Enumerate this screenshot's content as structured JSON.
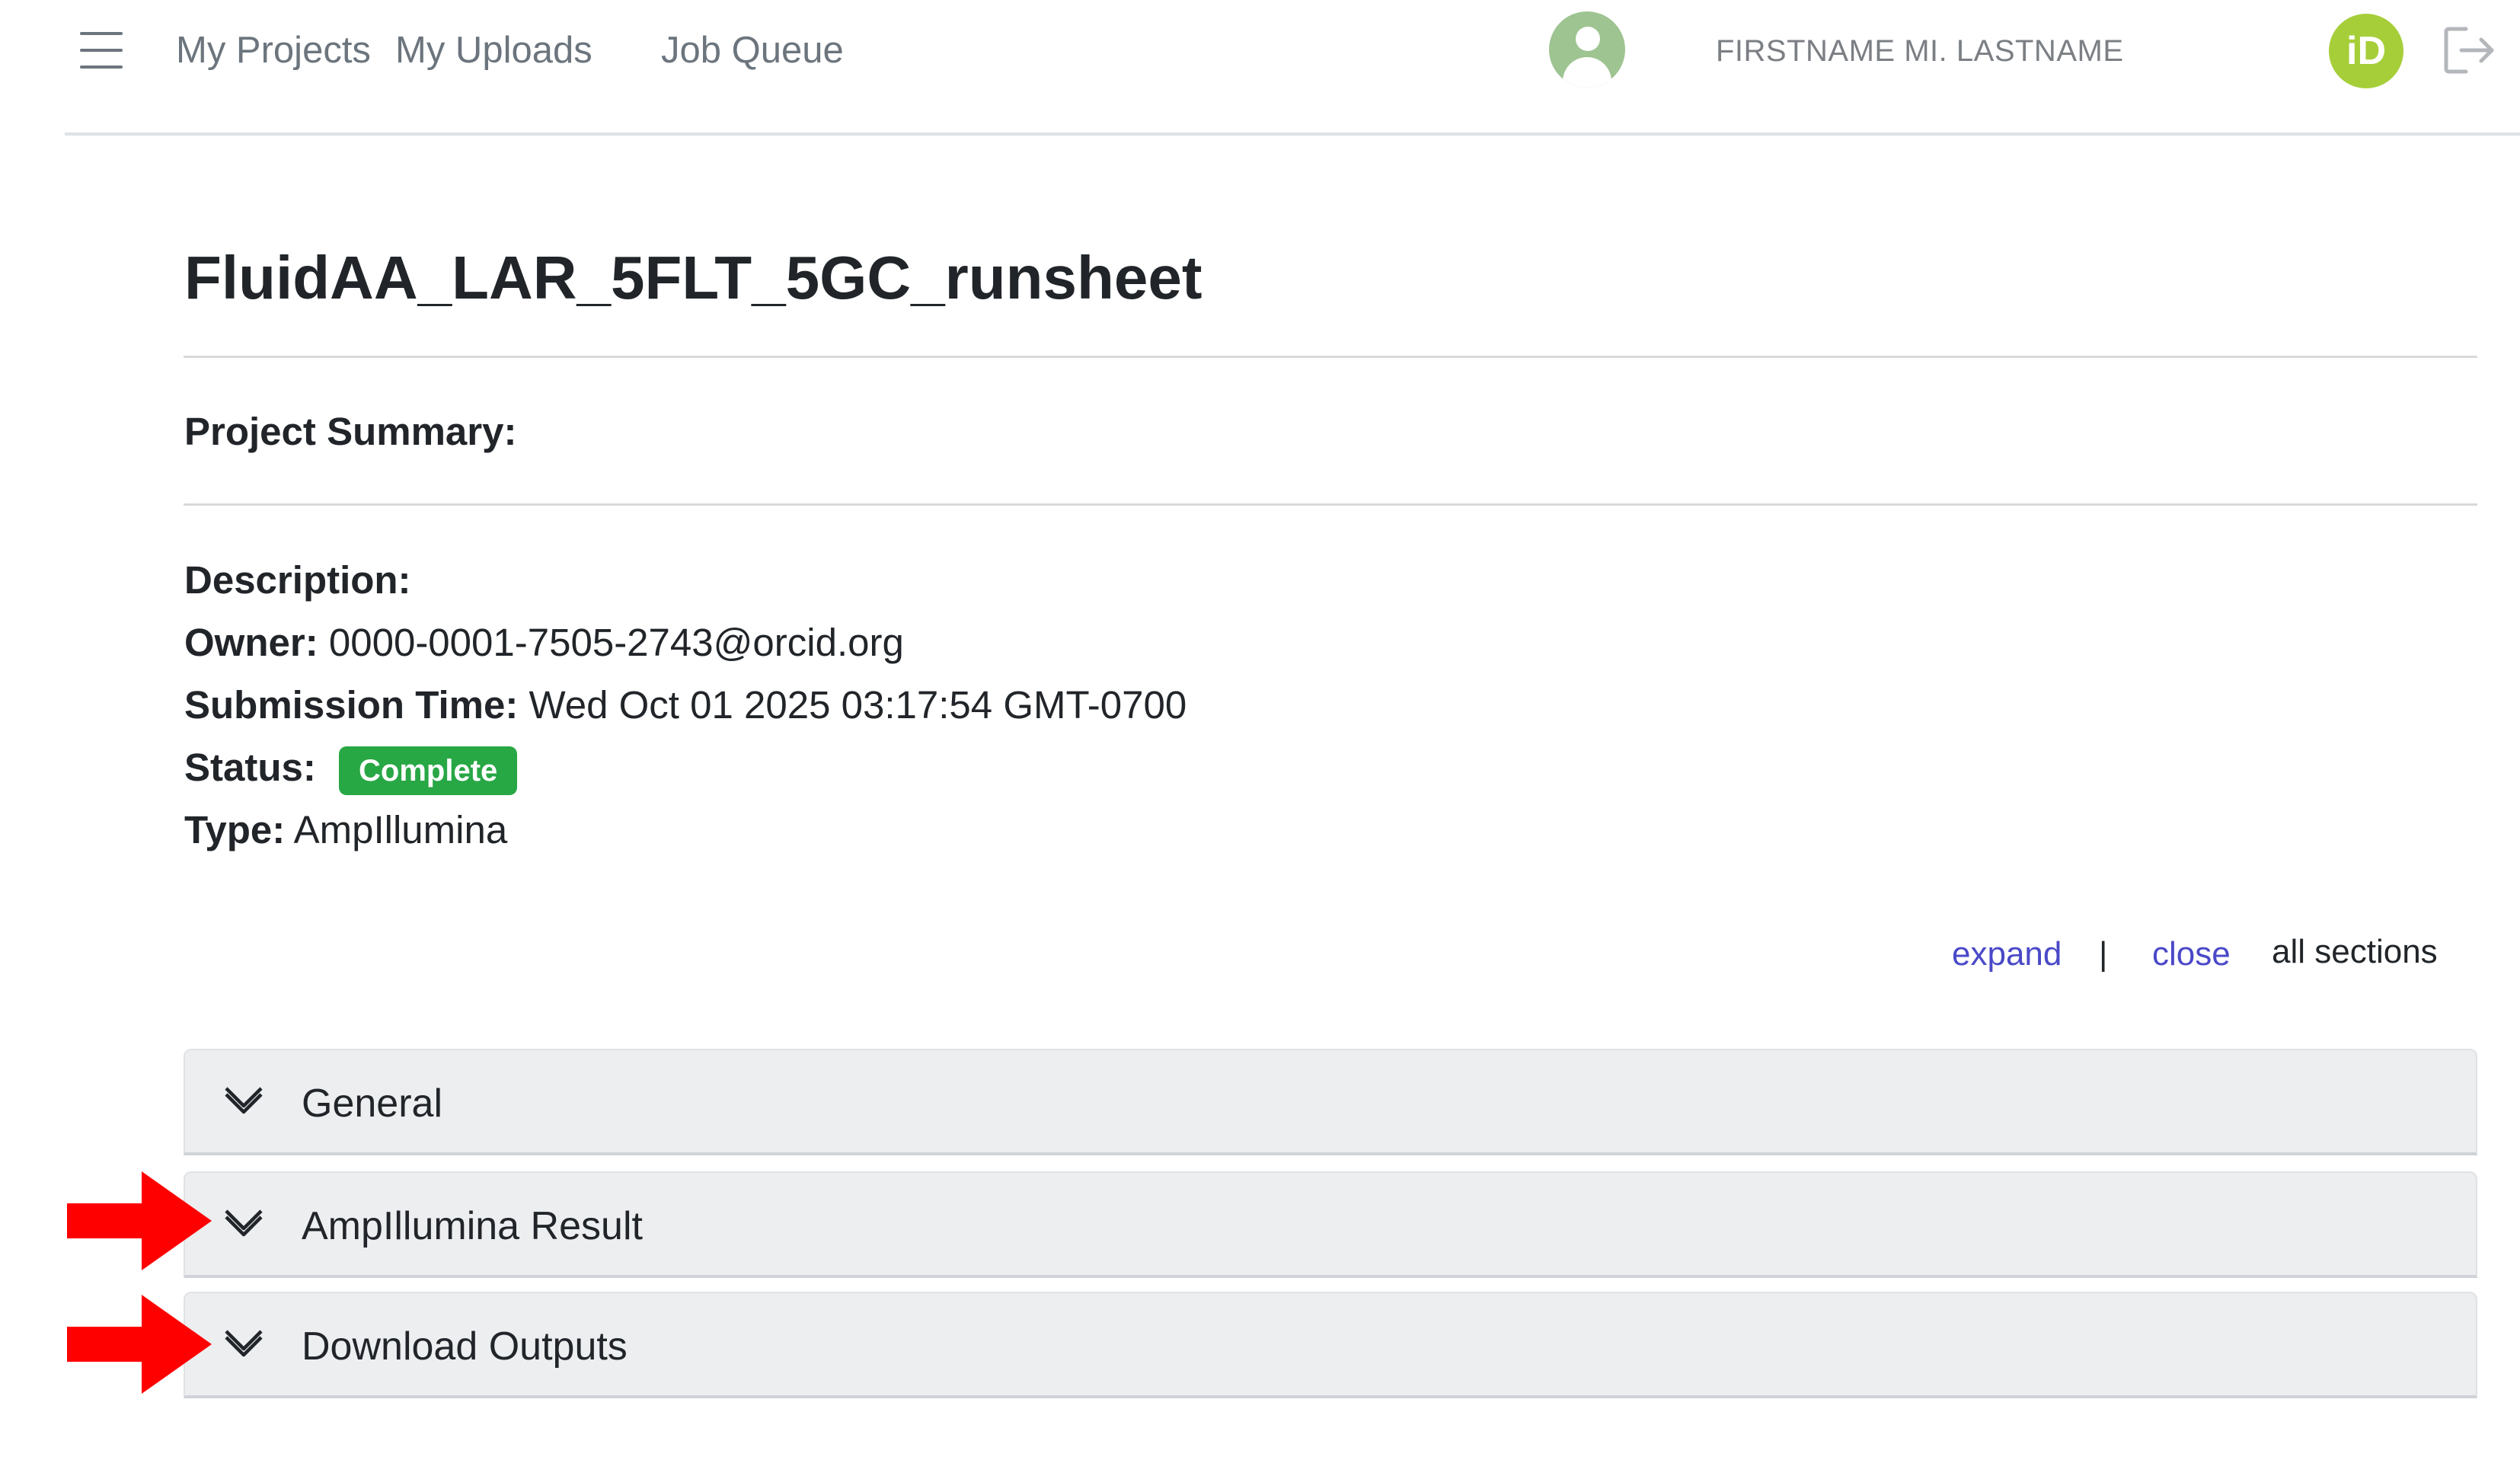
{
  "nav": {
    "links": [
      "My Projects",
      "My Uploads",
      "Job Queue"
    ],
    "username": "FIRSTNAME MI. LASTNAME",
    "orcid_badge": "iD"
  },
  "project": {
    "title": "FluidAA_LAR_5FLT_5GC_runsheet",
    "summary_label": "Project Summary:",
    "description_label": "Description:",
    "owner_label": "Owner:",
    "owner_value": "0000-0001-7505-2743@orcid.org",
    "submission_label": "Submission Time:",
    "submission_value": "Wed Oct 01 2025 03:17:54 GMT-0700",
    "status_label": "Status:",
    "status_value": "Complete",
    "type_label": "Type:",
    "type_value": "AmpIllumina"
  },
  "section_controls": {
    "expand": "expand",
    "separator": "|",
    "close": "close",
    "suffix": "all sections"
  },
  "sections": [
    "General",
    "AmpIllumina Result",
    "Download Outputs"
  ],
  "colors": {
    "status_green": "#28a745",
    "link_blue": "#4a49c8",
    "orcid_green": "#a6ce39",
    "annotation_red": "#ff0000"
  },
  "icons": {
    "menu": "hamburger-menu-icon",
    "user": "user-avatar-icon",
    "orcid": "orcid-icon",
    "logout": "logout-icon",
    "chevron": "chevron-down-icon",
    "annotation": "red-arrow-icon"
  }
}
